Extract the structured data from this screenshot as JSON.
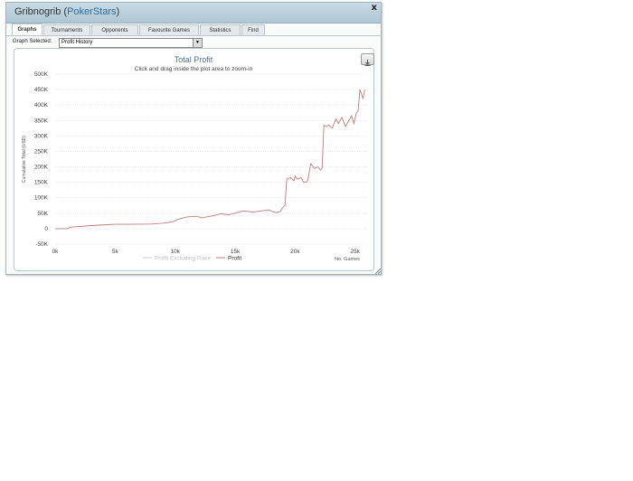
{
  "window": {
    "player": "Gribnogrib",
    "open_paren": "(",
    "site": "PokerStars",
    "close_paren": ")",
    "close_label": "x"
  },
  "tabs": [
    {
      "label": "Graphs",
      "active": true
    },
    {
      "label": "Tournaments",
      "active": false
    },
    {
      "label": "Opponents",
      "active": false
    },
    {
      "label": "Favourite Games",
      "active": false
    },
    {
      "label": "Statistics",
      "active": false
    },
    {
      "label": "Find",
      "active": false
    }
  ],
  "graph_selector": {
    "label": "Graph Selected:",
    "value": "Profit History"
  },
  "chart_data": {
    "type": "line",
    "title": "Total Profit",
    "subtitle": "Click and drag inside the plot area to zoom-in",
    "xlabel": "No. Games",
    "ylabel": "Cumulative Total (USD)",
    "xlim": [
      0,
      26000
    ],
    "ylim": [
      -50000,
      500000
    ],
    "x_ticks": [
      0,
      5000,
      10000,
      15000,
      20000,
      25000
    ],
    "x_tick_labels": [
      "0k",
      "5k",
      "10k",
      "15k",
      "20k",
      "25k"
    ],
    "y_ticks": [
      -50000,
      0,
      50000,
      100000,
      150000,
      200000,
      250000,
      300000,
      350000,
      400000,
      450000,
      500000
    ],
    "y_tick_labels": [
      "-50K",
      "0",
      "50K",
      "100K",
      "150K",
      "200K",
      "250K",
      "300K",
      "350K",
      "400K",
      "450K",
      "500K"
    ],
    "grid": true,
    "legend": "bottom-center",
    "series": [
      {
        "name": "Profit Excluding Rake",
        "color": "#d0d0d0",
        "visible": false,
        "x": [],
        "y": []
      },
      {
        "name": "Profit",
        "color": "#c27b7b",
        "visible": true,
        "x": [
          0,
          1000,
          1300,
          3000,
          4300,
          5000,
          6000,
          8000,
          9000,
          9800,
          10200,
          11000,
          11800,
          12200,
          12600,
          13200,
          13800,
          14500,
          15000,
          15500,
          15800,
          16500,
          17300,
          17800,
          18200,
          18500,
          18800,
          18900,
          19000,
          19150,
          19300,
          19600,
          19900,
          20000,
          20200,
          20500,
          20700,
          21000,
          21100,
          21300,
          21600,
          21900,
          22100,
          22250,
          22400,
          22600,
          22800,
          23100,
          23400,
          23600,
          23900,
          24200,
          24400,
          24700,
          24900,
          25100,
          25250,
          25400,
          25500,
          25650,
          25800
        ],
        "y": [
          0,
          0,
          5000,
          10000,
          13000,
          14000,
          14000,
          15000,
          18000,
          22000,
          30000,
          38000,
          40000,
          35000,
          38000,
          42000,
          48000,
          45000,
          50000,
          56000,
          57000,
          54000,
          58000,
          61000,
          54000,
          52000,
          57000,
          65000,
          70000,
          75000,
          160000,
          165000,
          155000,
          170000,
          160000,
          165000,
          150000,
          152000,
          165000,
          210000,
          195000,
          200000,
          190000,
          195000,
          335000,
          330000,
          335000,
          325000,
          355000,
          340000,
          360000,
          330000,
          345000,
          365000,
          340000,
          375000,
          380000,
          450000,
          440000,
          420000,
          450000
        ]
      }
    ]
  }
}
